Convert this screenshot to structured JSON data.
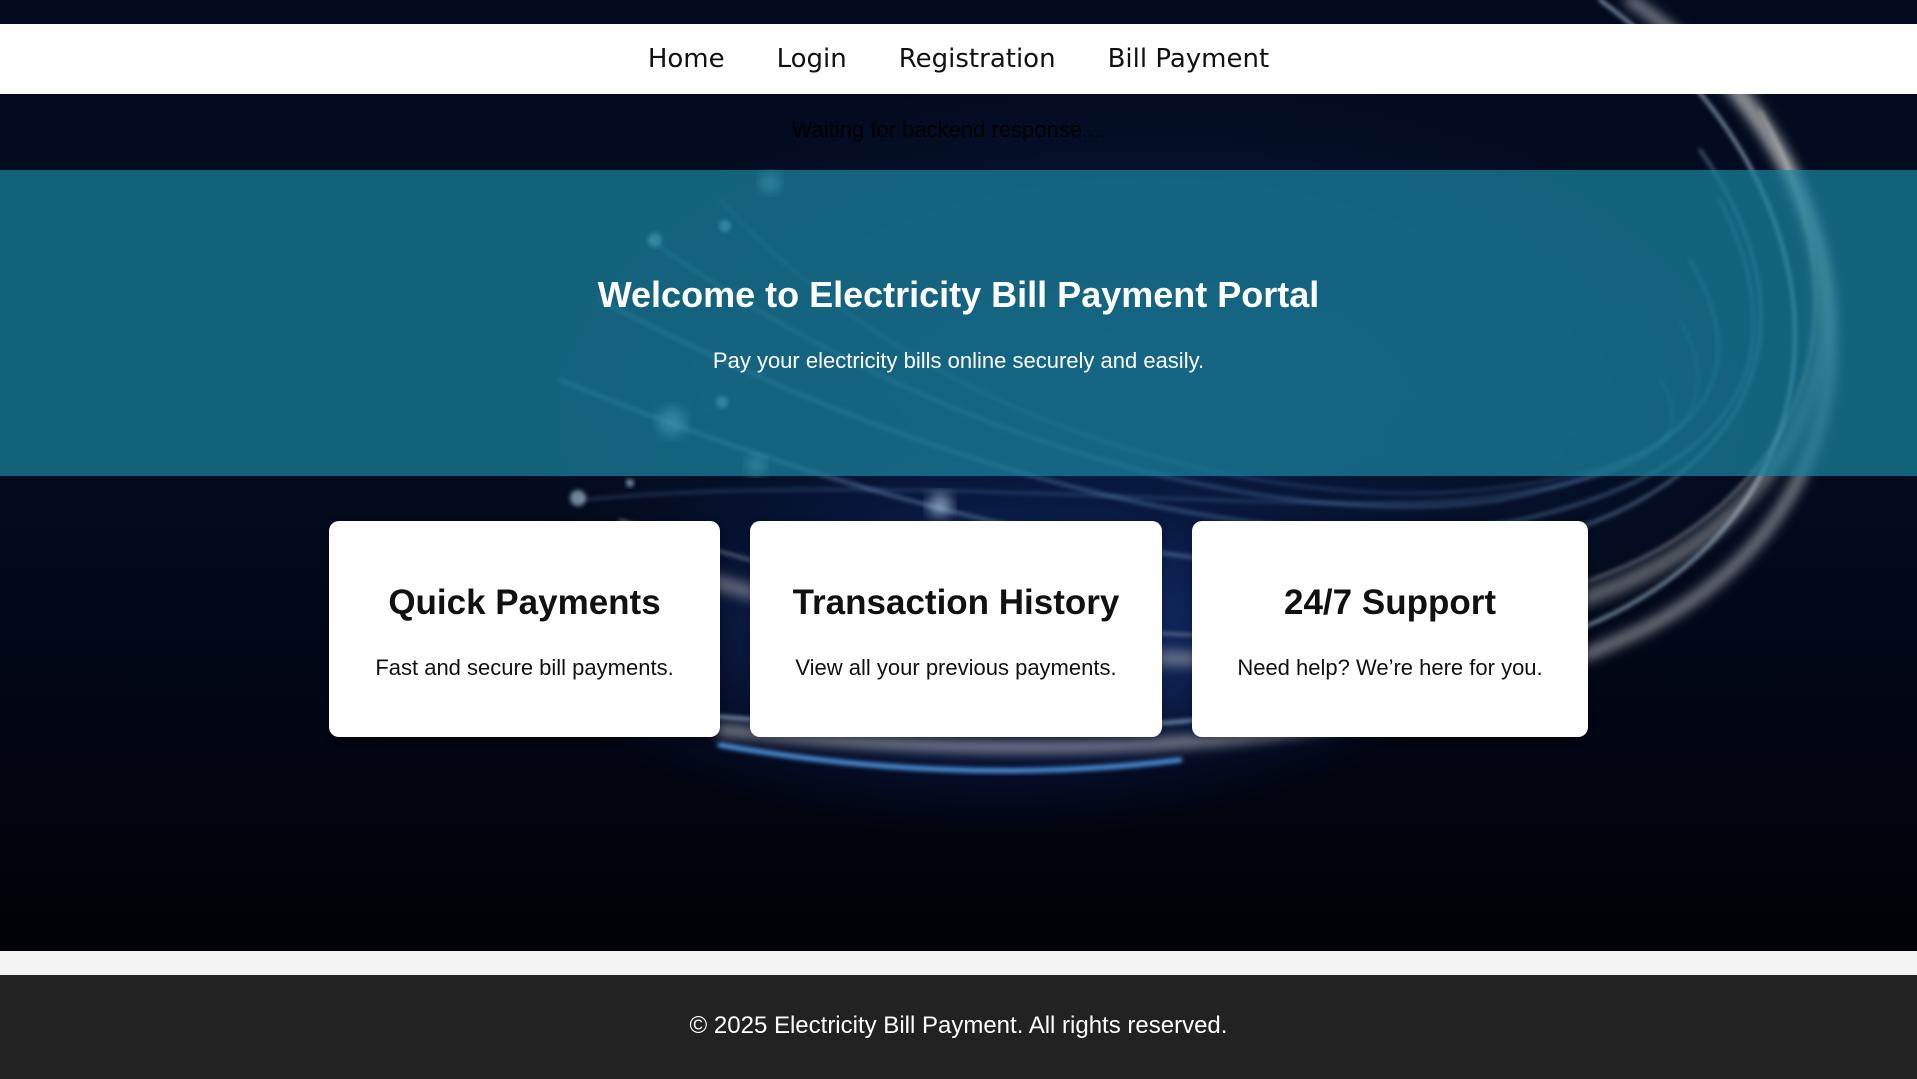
{
  "nav": {
    "items": [
      {
        "label": "Home"
      },
      {
        "label": "Login"
      },
      {
        "label": "Registration"
      },
      {
        "label": "Bill Payment"
      }
    ]
  },
  "status_text": "Waiting for backend response...",
  "hero": {
    "title": "Welcome to Electricity Bill Payment Portal",
    "subtitle": "Pay your electricity bills online securely and easily."
  },
  "features": [
    {
      "title": "Quick Payments",
      "description": "Fast and secure bill payments."
    },
    {
      "title": "Transaction History",
      "description": "View all your previous payments."
    },
    {
      "title": "24/7 Support",
      "description": "Need help? We’re here for you."
    }
  ],
  "footer": {
    "text": "© 2025 Electricity Bill Payment. All rights reserved."
  },
  "colors": {
    "nav_bg": "#ffffff",
    "hero_overlay": "#1a84a0",
    "footer_bg": "#222222",
    "card_bg": "#ffffff"
  }
}
